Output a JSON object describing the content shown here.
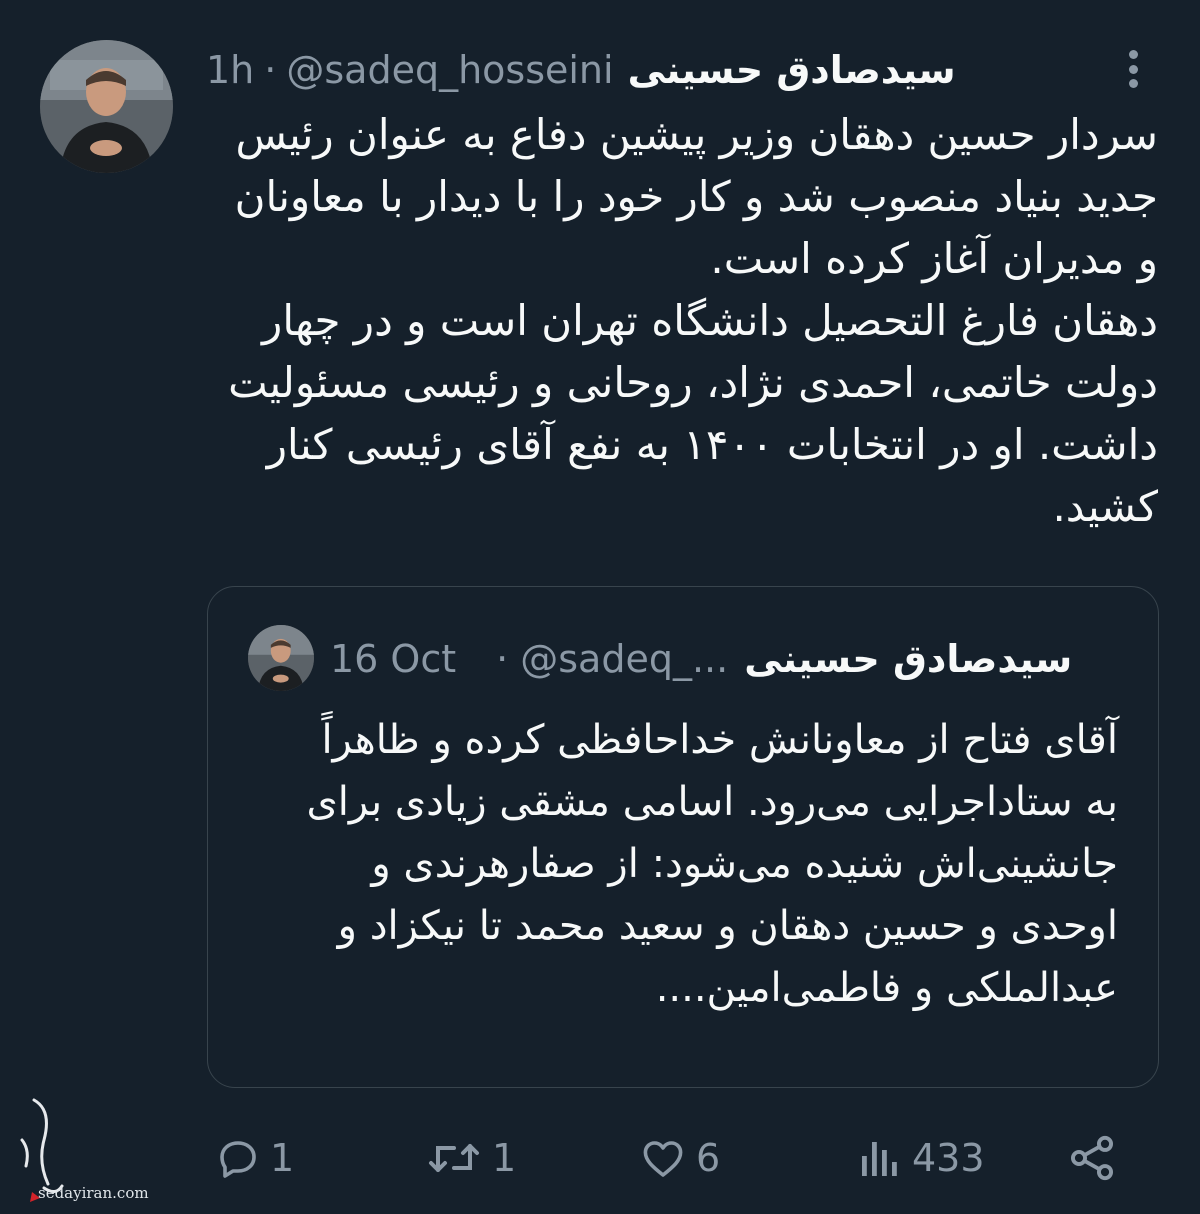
{
  "tweet": {
    "display_name": "سیدصادق حسینی",
    "handle": "@sadeq_hosseini",
    "separator": "·",
    "time": "1h",
    "text": "سردار حسین دهقان وزیر پیشین دفاع به عنوان رئیس\nجدید بنیاد منصوب شد و کار خود را با دیدار با معاونان\nو مدیران آغاز کرده است.\nدهقان فارغ التحصیل دانشگاه تهران است و در چهار\nدولت خاتمی، احمدی نژاد، روحانی و رئیسی مسئولیت\nداشت. او در انتخابات ۱۴۰۰ به نفع آقای رئیسی کنار\nکشید."
  },
  "quote": {
    "display_name": "سیدصادق حسینی",
    "handle": "@sadeq_...",
    "separator": "·",
    "time": "16 Oct",
    "text": "آقای فتاح از معاونانش خداحافظی کرده و ظاهراً\nبه ستاداجرایی می‌رود. اسامی مشقی زیادی برای\nجانشینی‌اش شنیده می‌شود: از صفارهرندی و\nاوحدی و حسین دهقان و سعید محمد تا نیکزاد و\nعبدالملکی و فاطمی‌امین...."
  },
  "actions": {
    "reply_count": "1",
    "retweet_count": "1",
    "like_count": "6",
    "views_count": "433"
  },
  "icons": {
    "reply": "reply-icon",
    "retweet": "retweet-icon",
    "like": "heart-icon",
    "views": "views-icon",
    "share": "share-icon",
    "more": "more-options-icon"
  },
  "watermark": {
    "site": "sedayiran.com",
    "logo_text": "صدای ایران"
  },
  "colors": {
    "background": "#15202b",
    "text": "#f7f9f9",
    "muted": "#8b98a5",
    "border": "#38444d"
  }
}
